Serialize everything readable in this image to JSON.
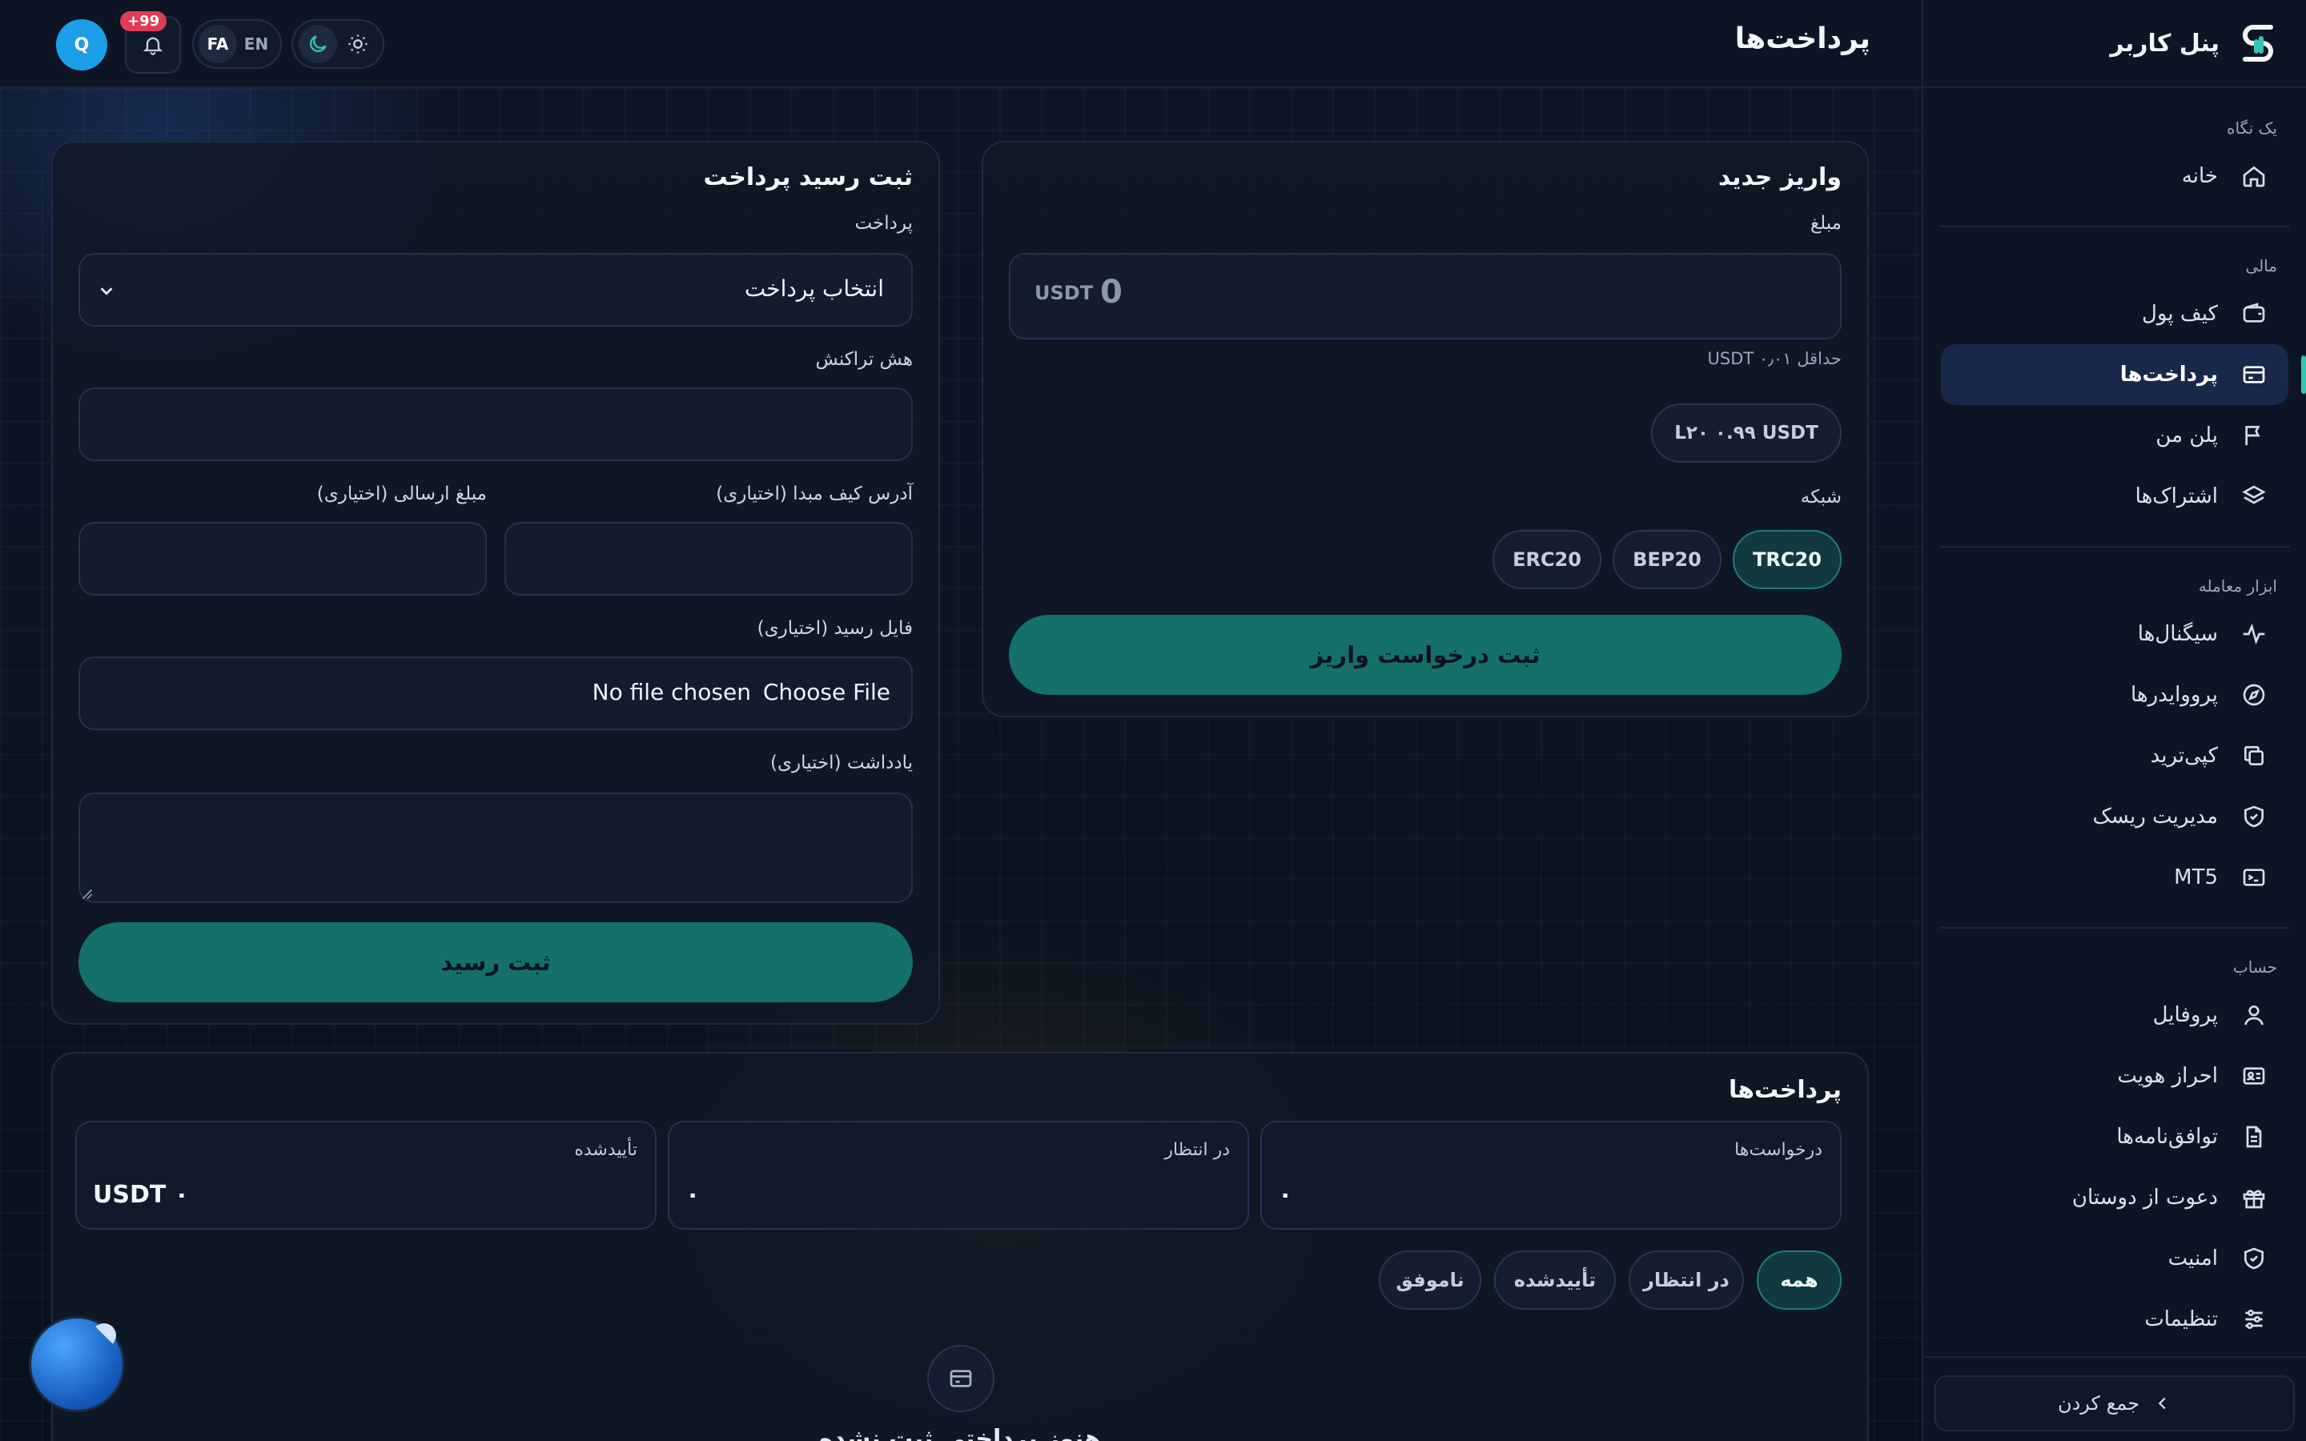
{
  "header": {
    "title": "پرداخت‌ها",
    "avatar_initial": "Q",
    "notifications_badge": "+99",
    "lang_fa": "FA",
    "lang_en": "EN"
  },
  "sidebar": {
    "brand": "پنل کاربر",
    "sections": {
      "overview": "یک نگاه",
      "finance": "مالی",
      "tools": "ابزار معامله",
      "account": "حساب"
    },
    "items": {
      "home": "خانه",
      "wallet": "کیف پول",
      "payments": "پرداخت‌ها",
      "my_plan": "پلن من",
      "subscriptions": "اشتراک‌ها",
      "signals": "سیگنال‌ها",
      "providers": "پرووایدرها",
      "copytrade": "کپی‌ترید",
      "risk": "مدیریت ریسک",
      "mt5": "MT5",
      "profile": "پروفایل",
      "kyc": "احراز هویت",
      "agreements": "توافق‌نامه‌ها",
      "invite": "دعوت از دوستان",
      "security": "امنیت",
      "settings": "تنظیمات"
    },
    "collapse": "جمع کردن"
  },
  "deposit": {
    "title": "واریز جدید",
    "amount_label": "مبلغ",
    "amount_value": "0",
    "currency": "USDT",
    "min_text": "حداقل USDT ۰٫۰۱",
    "fee_chip": "L۲۰ ۰.۹۹ USDT",
    "network_label": "شبکه",
    "networks": [
      "TRC20",
      "BEP20",
      "ERC20"
    ],
    "submit": "ثبت درخواست واریز"
  },
  "receipt": {
    "title": "ثبت رسید پرداخت",
    "payment_label": "پرداخت",
    "payment_select": "انتخاب پرداخت",
    "tx_hash_label": "هش تراکنش",
    "source_wallet_label": "آدرس کیف مبدا (اختیاری)",
    "sent_amount_label": "مبلغ ارسالی (اختیاری)",
    "file_label": "فایل رسید (اختیاری)",
    "file_button": "Choose File",
    "file_status": "No file chosen",
    "note_label": "یادداشت (اختیاری)",
    "submit": "ثبت رسید"
  },
  "payments": {
    "title": "پرداخت‌ها",
    "stats": {
      "requests_label": "درخواست‌ها",
      "requests_value": "۰",
      "pending_label": "در انتظار",
      "pending_value": "۰",
      "confirmed_label": "تأییدشده",
      "confirmed_value": "USDT ۰"
    },
    "filters": [
      "همه",
      "در انتظار",
      "تأییدشده",
      "ناموفق"
    ],
    "empty_text": "هنوز پرداختی ثبت نشده"
  },
  "colors": {
    "accent": "#2fc9b1",
    "primary_button": "#15706a",
    "active_nav": "#17284a",
    "badge": "#e23a55"
  }
}
